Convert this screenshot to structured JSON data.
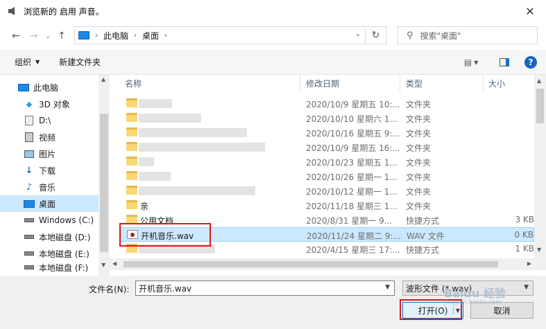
{
  "title": "浏览新的 启用 声音。",
  "close_glyph": "✕",
  "address": {
    "crumbs": [
      "此电脑",
      "桌面"
    ]
  },
  "search": {
    "placeholder": "搜索\"桌面\""
  },
  "toolbar": {
    "organize": "组织",
    "new_folder": "新建文件夹"
  },
  "nav": [
    {
      "label": "此电脑",
      "icon": "pc-icon",
      "root": true
    },
    {
      "label": "3D 对象",
      "icon": "3d-objects-icon"
    },
    {
      "label": "D:\\",
      "icon": "drive-icon"
    },
    {
      "label": "视频",
      "icon": "video-icon"
    },
    {
      "label": "图片",
      "icon": "pictures-icon"
    },
    {
      "label": "下载",
      "icon": "download-icon"
    },
    {
      "label": "音乐",
      "icon": "music-icon"
    },
    {
      "label": "桌面",
      "icon": "desktop-icon",
      "selected": true
    },
    {
      "label": "Windows (C:)",
      "icon": "drive-icon"
    },
    {
      "label": "本地磁盘 (D:)",
      "icon": "drive-icon"
    },
    {
      "label": "本地磁盘 (E:)",
      "icon": "drive-icon"
    },
    {
      "label": "本地磁盘 (F:)",
      "icon": "drive-icon"
    }
  ],
  "columns": {
    "name": "名称",
    "date": "修改日期",
    "type": "类型",
    "size": "大小"
  },
  "rows": [
    {
      "name": "",
      "date": "2020/10/9 星期五 10:...",
      "type": "文件夹",
      "size": "",
      "kind": "folder"
    },
    {
      "name": "",
      "date": "2020/10/10 星期六 1...",
      "type": "文件夹",
      "size": "",
      "kind": "folder"
    },
    {
      "name": "",
      "date": "2020/10/16 星期五 9:...",
      "type": "文件夹",
      "size": "",
      "kind": "folder"
    },
    {
      "name": "",
      "date": "2020/10/9 星期五 16:...",
      "type": "文件夹",
      "size": "",
      "kind": "folder"
    },
    {
      "name": "",
      "date": "2020/10/23 星期五 1...",
      "type": "文件夹",
      "size": "",
      "kind": "folder"
    },
    {
      "name": "",
      "date": "2020/10/26 星期一 1...",
      "type": "文件夹",
      "size": "",
      "kind": "folder"
    },
    {
      "name": "",
      "date": "2020/10/12 星期一 1...",
      "type": "文件夹",
      "size": "",
      "kind": "folder"
    },
    {
      "name": "亲",
      "date": "2020/11/18 星期三 1...",
      "type": "文件夹",
      "size": "",
      "kind": "folder"
    },
    {
      "name": "公用文档",
      "date": "2020/8/31 星期一 9...",
      "type": "快捷方式",
      "size": "3 KB",
      "kind": "shortcut"
    },
    {
      "name": "开机音乐.wav",
      "date": "2020/11/24 星期二 9:...",
      "type": "WAV 文件",
      "size": "0 KB",
      "kind": "wav",
      "selected": true
    },
    {
      "name": "",
      "date": "2020/4/15 星期三 17:...",
      "type": "快捷方式",
      "size": "1 KB",
      "kind": "shortcut"
    }
  ],
  "bottom": {
    "filename_label": "文件名(N):",
    "filename_value": "开机音乐.wav",
    "filetype_value": "波形文件 (*.wav)",
    "open_label": "打开(O)",
    "cancel_label": "取消"
  },
  "watermark": {
    "line1": "Baidu 经验",
    "line2": "jingyan.baidu.com"
  }
}
